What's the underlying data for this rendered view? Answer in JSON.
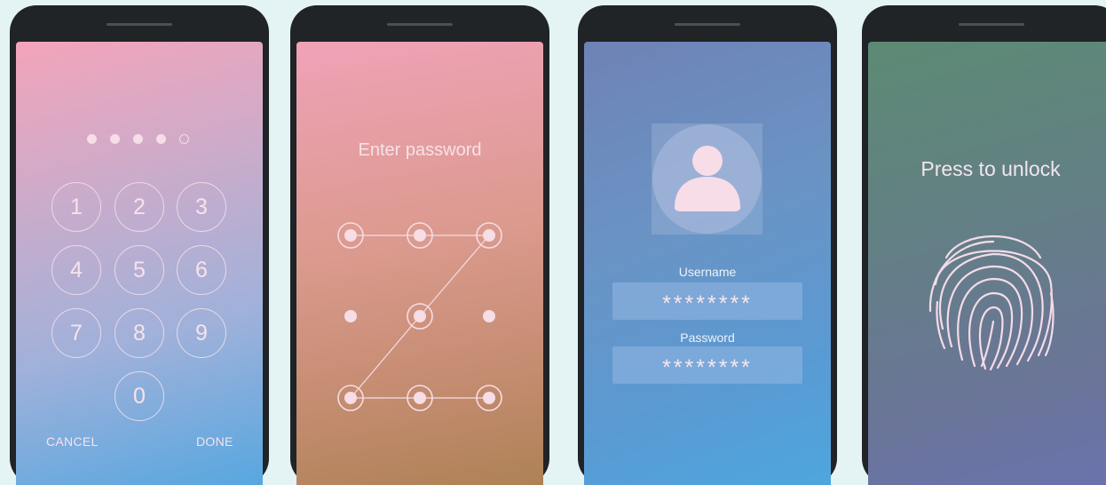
{
  "pin_screen": {
    "entered_digits": 4,
    "total_digits": 5,
    "keys": [
      "1",
      "2",
      "3",
      "4",
      "5",
      "6",
      "7",
      "8",
      "9",
      "0"
    ],
    "cancel_label": "CANCEL",
    "done_label": "DONE"
  },
  "pattern_screen": {
    "title": "Enter password"
  },
  "login_screen": {
    "username_label": "Username",
    "username_value": "********",
    "password_label": "Password",
    "password_value": "********"
  },
  "fingerprint_screen": {
    "title": "Press to unlock"
  },
  "colors": {
    "page_background": "#e4f3f3",
    "phone_body": "#202427",
    "ui_foreground": "#f6dde7"
  },
  "icons": [
    "user-avatar-icon",
    "fingerprint-icon"
  ]
}
